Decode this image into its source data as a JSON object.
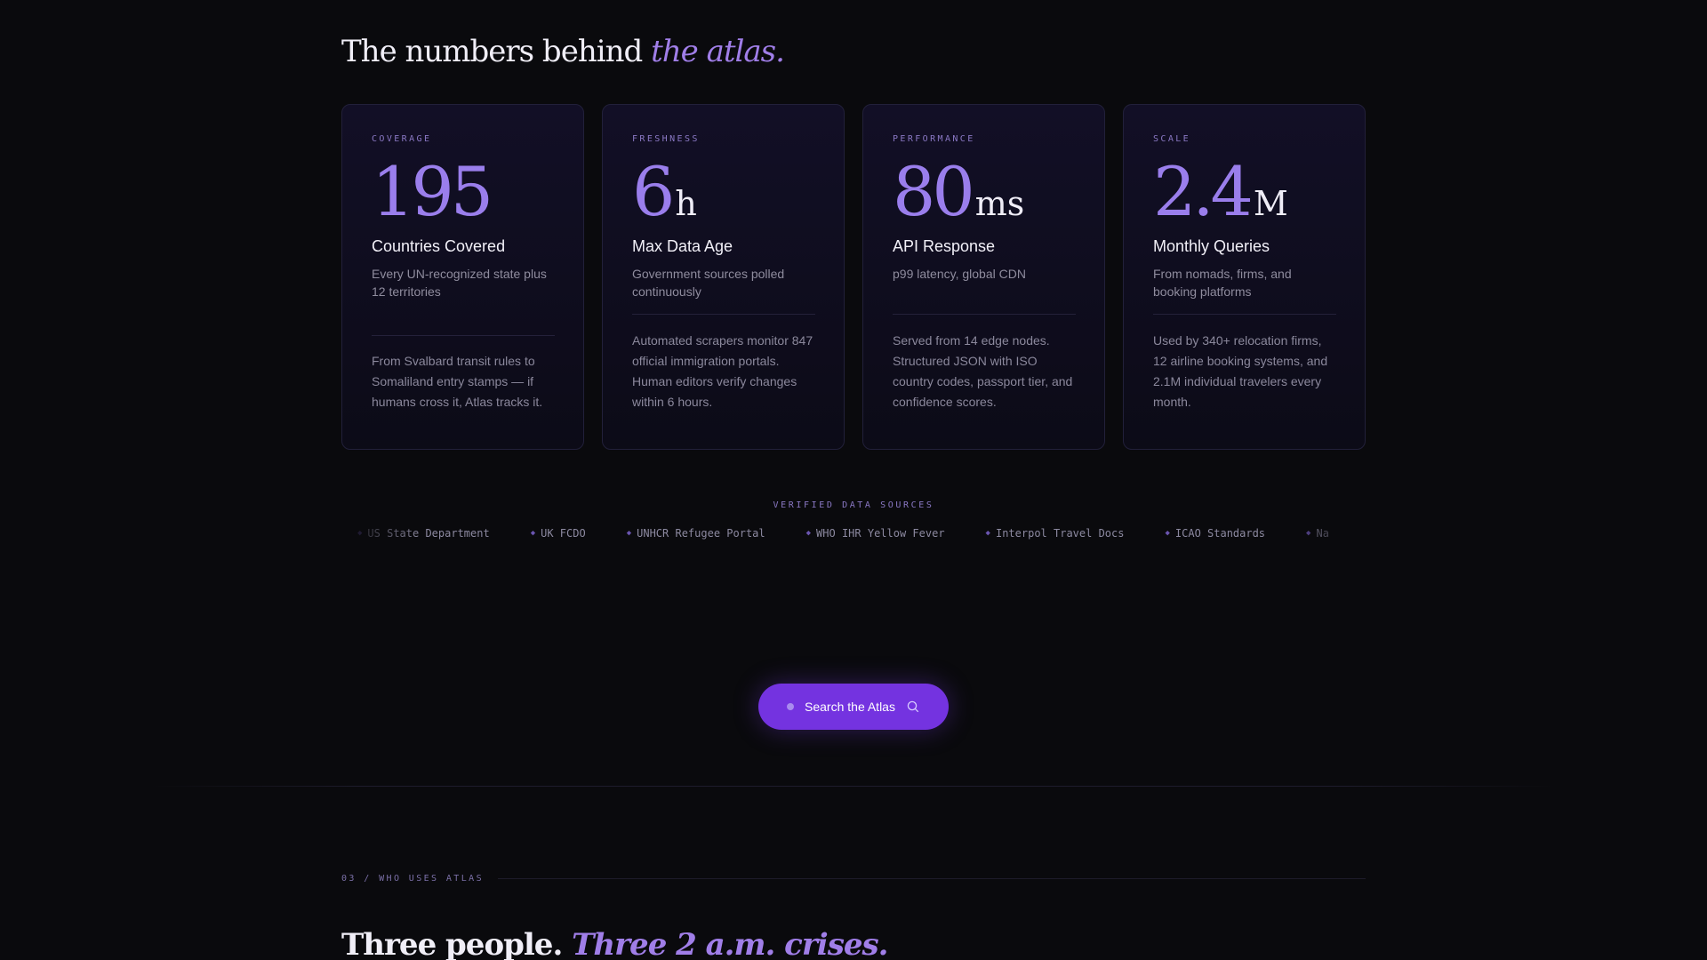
{
  "stats_section": {
    "heading_main": "The numbers behind",
    "heading_accent": "the atlas."
  },
  "cards": [
    {
      "eyebrow": "COVERAGE",
      "number": "195",
      "unit": "",
      "title": "Countries Covered",
      "subtitle": "Every UN-recognized state plus 12 territories",
      "body": "From Svalbard transit rules to Somaliland entry stamps — if humans cross it, Atlas tracks it."
    },
    {
      "eyebrow": "FRESHNESS",
      "number": "6",
      "unit": "h",
      "title": "Max Data Age",
      "subtitle": "Government sources polled continuously",
      "body": "Automated scrapers monitor 847 official immigration portals. Human editors verify changes within 6 hours."
    },
    {
      "eyebrow": "PERFORMANCE",
      "number": "80",
      "unit": "ms",
      "title": "API Response",
      "subtitle": "p99 latency, global CDN",
      "body": "Served from 14 edge nodes. Structured JSON with ISO country codes, passport tier, and confidence scores."
    },
    {
      "eyebrow": "SCALE",
      "number": "2.4",
      "unit": "M",
      "title": "Monthly Queries",
      "subtitle": "From nomads, firms, and booking platforms",
      "body": "Used by 340+ relocation firms, 12 airline booking systems, and 2.1M individual travelers every month."
    }
  ],
  "sources": {
    "label": "VERIFIED DATA SOURCES",
    "items": [
      "US State Department",
      "UK FCDO",
      "UNHCR Refugee Portal",
      "WHO IHR Yellow Fever",
      "Interpol Travel Docs",
      "ICAO Standards",
      "Na"
    ],
    "bullet": "◆"
  },
  "cta": {
    "label": "Search the Atlas",
    "icon": "search-icon"
  },
  "next_section": {
    "tag": "03 / WHO USES ATLAS",
    "heading_main": "Three people.",
    "heading_accent": "Three 2 a.m. crises."
  },
  "colors": {
    "background": "#0a0a0d",
    "accent": "#9a7eec",
    "button": "#7433e0"
  }
}
